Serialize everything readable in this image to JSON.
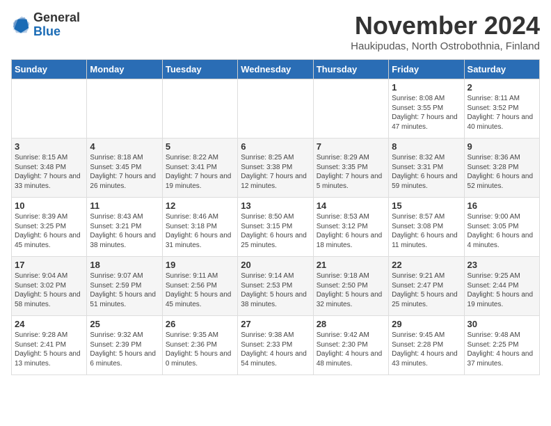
{
  "header": {
    "logo_general": "General",
    "logo_blue": "Blue",
    "month_title": "November 2024",
    "location": "Haukipudas, North Ostrobothnia, Finland"
  },
  "days_of_week": [
    "Sunday",
    "Monday",
    "Tuesday",
    "Wednesday",
    "Thursday",
    "Friday",
    "Saturday"
  ],
  "weeks": [
    [
      {
        "day": "",
        "content": ""
      },
      {
        "day": "",
        "content": ""
      },
      {
        "day": "",
        "content": ""
      },
      {
        "day": "",
        "content": ""
      },
      {
        "day": "",
        "content": ""
      },
      {
        "day": "1",
        "content": "Sunrise: 8:08 AM\nSunset: 3:55 PM\nDaylight: 7 hours\nand 47 minutes."
      },
      {
        "day": "2",
        "content": "Sunrise: 8:11 AM\nSunset: 3:52 PM\nDaylight: 7 hours\nand 40 minutes."
      }
    ],
    [
      {
        "day": "3",
        "content": "Sunrise: 8:15 AM\nSunset: 3:48 PM\nDaylight: 7 hours\nand 33 minutes."
      },
      {
        "day": "4",
        "content": "Sunrise: 8:18 AM\nSunset: 3:45 PM\nDaylight: 7 hours\nand 26 minutes."
      },
      {
        "day": "5",
        "content": "Sunrise: 8:22 AM\nSunset: 3:41 PM\nDaylight: 7 hours\nand 19 minutes."
      },
      {
        "day": "6",
        "content": "Sunrise: 8:25 AM\nSunset: 3:38 PM\nDaylight: 7 hours\nand 12 minutes."
      },
      {
        "day": "7",
        "content": "Sunrise: 8:29 AM\nSunset: 3:35 PM\nDaylight: 7 hours\nand 5 minutes."
      },
      {
        "day": "8",
        "content": "Sunrise: 8:32 AM\nSunset: 3:31 PM\nDaylight: 6 hours\nand 59 minutes."
      },
      {
        "day": "9",
        "content": "Sunrise: 8:36 AM\nSunset: 3:28 PM\nDaylight: 6 hours\nand 52 minutes."
      }
    ],
    [
      {
        "day": "10",
        "content": "Sunrise: 8:39 AM\nSunset: 3:25 PM\nDaylight: 6 hours\nand 45 minutes."
      },
      {
        "day": "11",
        "content": "Sunrise: 8:43 AM\nSunset: 3:21 PM\nDaylight: 6 hours\nand 38 minutes."
      },
      {
        "day": "12",
        "content": "Sunrise: 8:46 AM\nSunset: 3:18 PM\nDaylight: 6 hours\nand 31 minutes."
      },
      {
        "day": "13",
        "content": "Sunrise: 8:50 AM\nSunset: 3:15 PM\nDaylight: 6 hours\nand 25 minutes."
      },
      {
        "day": "14",
        "content": "Sunrise: 8:53 AM\nSunset: 3:12 PM\nDaylight: 6 hours\nand 18 minutes."
      },
      {
        "day": "15",
        "content": "Sunrise: 8:57 AM\nSunset: 3:08 PM\nDaylight: 6 hours\nand 11 minutes."
      },
      {
        "day": "16",
        "content": "Sunrise: 9:00 AM\nSunset: 3:05 PM\nDaylight: 6 hours\nand 4 minutes."
      }
    ],
    [
      {
        "day": "17",
        "content": "Sunrise: 9:04 AM\nSunset: 3:02 PM\nDaylight: 5 hours\nand 58 minutes."
      },
      {
        "day": "18",
        "content": "Sunrise: 9:07 AM\nSunset: 2:59 PM\nDaylight: 5 hours\nand 51 minutes."
      },
      {
        "day": "19",
        "content": "Sunrise: 9:11 AM\nSunset: 2:56 PM\nDaylight: 5 hours\nand 45 minutes."
      },
      {
        "day": "20",
        "content": "Sunrise: 9:14 AM\nSunset: 2:53 PM\nDaylight: 5 hours\nand 38 minutes."
      },
      {
        "day": "21",
        "content": "Sunrise: 9:18 AM\nSunset: 2:50 PM\nDaylight: 5 hours\nand 32 minutes."
      },
      {
        "day": "22",
        "content": "Sunrise: 9:21 AM\nSunset: 2:47 PM\nDaylight: 5 hours\nand 25 minutes."
      },
      {
        "day": "23",
        "content": "Sunrise: 9:25 AM\nSunset: 2:44 PM\nDaylight: 5 hours\nand 19 minutes."
      }
    ],
    [
      {
        "day": "24",
        "content": "Sunrise: 9:28 AM\nSunset: 2:41 PM\nDaylight: 5 hours\nand 13 minutes."
      },
      {
        "day": "25",
        "content": "Sunrise: 9:32 AM\nSunset: 2:39 PM\nDaylight: 5 hours\nand 6 minutes."
      },
      {
        "day": "26",
        "content": "Sunrise: 9:35 AM\nSunset: 2:36 PM\nDaylight: 5 hours\nand 0 minutes."
      },
      {
        "day": "27",
        "content": "Sunrise: 9:38 AM\nSunset: 2:33 PM\nDaylight: 4 hours\nand 54 minutes."
      },
      {
        "day": "28",
        "content": "Sunrise: 9:42 AM\nSunset: 2:30 PM\nDaylight: 4 hours\nand 48 minutes."
      },
      {
        "day": "29",
        "content": "Sunrise: 9:45 AM\nSunset: 2:28 PM\nDaylight: 4 hours\nand 43 minutes."
      },
      {
        "day": "30",
        "content": "Sunrise: 9:48 AM\nSunset: 2:25 PM\nDaylight: 4 hours\nand 37 minutes."
      }
    ]
  ]
}
